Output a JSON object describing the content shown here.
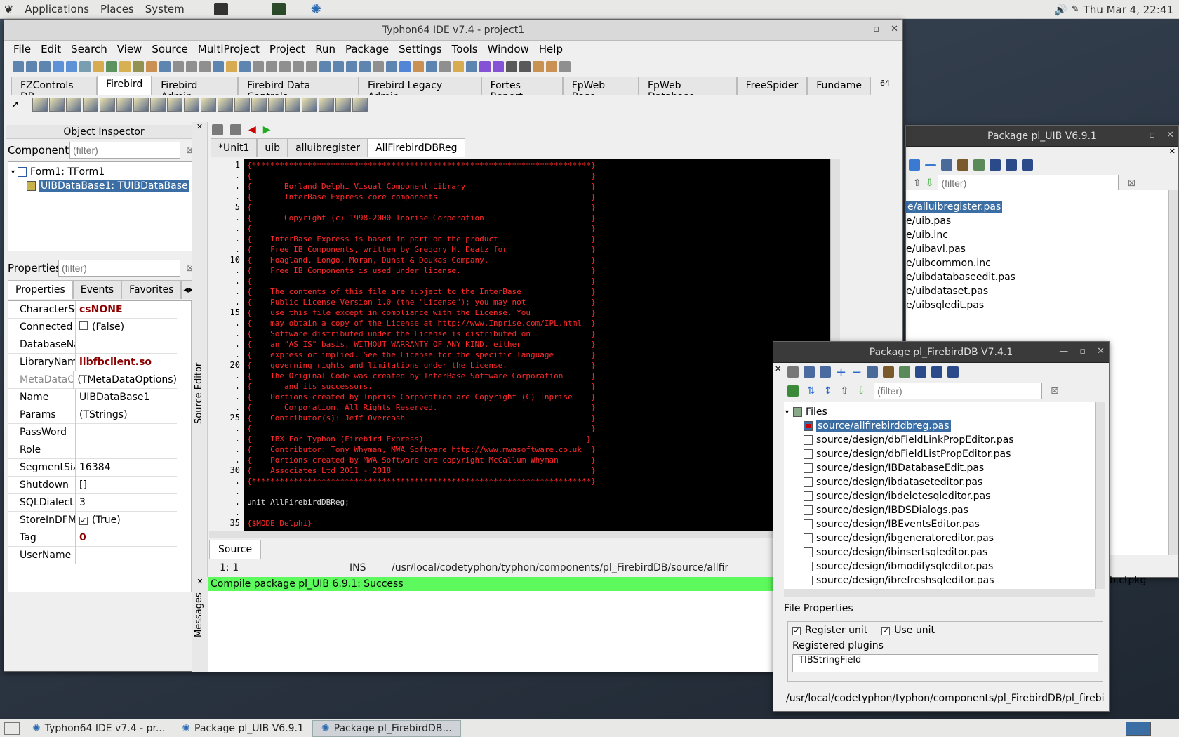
{
  "topbar": {
    "applications": "Applications",
    "places": "Places",
    "system": "System",
    "clock": "Thu Mar  4, 22:41"
  },
  "ide": {
    "title": "Typhon64 IDE v7.4 - project1",
    "menu": [
      "File",
      "Edit",
      "Search",
      "View",
      "Source",
      "MultiProject",
      "Project",
      "Run",
      "Package",
      "Settings",
      "Tools",
      "Window",
      "Help"
    ],
    "palette_tabs": [
      "FZControls DB",
      "Firebird",
      "Firebird Admin",
      "Firebird Data Controls",
      "Firebird Legacy Admin",
      "Fortes Report",
      "FpWeb Base",
      "FpWeb Database",
      "FreeSpider",
      "Fundame"
    ],
    "palette_selected": "Firebird",
    "palette_bits_label": "64"
  },
  "inspector": {
    "title": "Object Inspector",
    "components_label": "Components",
    "filter_placeholder": "(filter)",
    "tree": [
      "Form1: TForm1",
      "UIBDataBase1: TUIBDataBase"
    ],
    "properties_label": "Properties",
    "tabs": [
      "Properties",
      "Events",
      "Favorites"
    ],
    "props": [
      {
        "k": "CharacterSet",
        "v": "csNONE",
        "red": true
      },
      {
        "k": "Connected",
        "v": "(False)",
        "check": "off"
      },
      {
        "k": "DatabaseNam",
        "v": ""
      },
      {
        "k": "LibraryName",
        "v": "libfbclient.so",
        "red": true
      },
      {
        "k": "MetaDataOpt",
        "v": "(TMetaDataOptions)",
        "gray": true
      },
      {
        "k": "Name",
        "v": "UIBDataBase1"
      },
      {
        "k": "Params",
        "v": "(TStrings)"
      },
      {
        "k": "PassWord",
        "v": ""
      },
      {
        "k": "Role",
        "v": ""
      },
      {
        "k": "SegmentSize",
        "v": "16384"
      },
      {
        "k": "Shutdown",
        "v": "[]"
      },
      {
        "k": "SQLDialect",
        "v": "3"
      },
      {
        "k": "StoreInDFM",
        "v": "(True)",
        "check": "on"
      },
      {
        "k": "Tag",
        "v": "0",
        "red": true
      },
      {
        "k": "UserName",
        "v": ""
      }
    ]
  },
  "editor": {
    "side_label": "Source Editor",
    "tabs": [
      "*Unit1",
      "uib",
      "alluibregister",
      "AllFirebirdDBReg"
    ],
    "gutter": [
      "1",
      ".",
      ".",
      ".",
      "5",
      ".",
      ".",
      ".",
      ".",
      "10",
      ".",
      ".",
      ".",
      ".",
      "15",
      ".",
      ".",
      ".",
      ".",
      "20",
      ".",
      ".",
      ".",
      ".",
      "25",
      ".",
      ".",
      ".",
      ".",
      "30",
      ".",
      ".",
      ".",
      ".",
      "35"
    ],
    "lines": [
      "{*************************************************************************}",
      "{                                                                         }",
      "{       Borland Delphi Visual Component Library                           }",
      "{       InterBase Express core components                                 }",
      "{                                                                         }",
      "{       Copyright (c) 1998-2000 Inprise Corporation                       }",
      "{                                                                         }",
      "{    InterBase Express is based in part on the product                    }",
      "{    Free IB Components, written by Gregory H. Deatz for                  }",
      "{    Hoagland, Longo, Moran, Dunst & Doukas Company.                      }",
      "{    Free IB Components is used under license.                            }",
      "{                                                                         }",
      "{    The contents of this file are subject to the InterBase               }",
      "{    Public License Version 1.0 (the \"License\"); you may not              }",
      "{    use this file except in compliance with the License. You             }",
      "{    may obtain a copy of the License at http://www.Inprise.com/IPL.html  }",
      "{    Software distributed under the License is distributed on             }",
      "{    an \"AS IS\" basis, WITHOUT WARRANTY OF ANY KIND, either               }",
      "{    express or implied. See the License for the specific language        }",
      "{    governing rights and limitations under the License.                  }",
      "{    The Original Code was created by InterBase Software Corporation      }",
      "{       and its successors.                                               }",
      "{    Portions created by Inprise Corporation are Copyright (C) Inprise    }",
      "{       Corporation. All Rights Reserved.                                 }",
      "{    Contributor(s): Jeff Overcash                                        }",
      "{                                                                         }",
      "{    IBX For Typhon (Firebird Express)                                   }",
      "{    Contributor: Tony Whyman, MWA Software http://www.mwasoftware.co.uk  }",
      "{    Portions created by MWA Software are copyright McCallum Whyman       }",
      "{    Associates Ltd 2011 - 2018                                           }",
      "{*************************************************************************}",
      "",
      "unit AllFirebirdDBReg;",
      "",
      "{$MODE Delphi}"
    ],
    "bottom_tab": "Source",
    "status_pos": "1:  1",
    "status_mode": "INS",
    "status_path": "/usr/local/codetyphon/typhon/components/pl_FirebirdDB/source/allfir"
  },
  "messages": {
    "label": "Messages",
    "text": "Compile package pl_UIB 6.9.1: Success"
  },
  "pkg_uib": {
    "title": "Package pl_UIB V6.9.1",
    "filter_placeholder": "(filter)",
    "files": [
      "e/alluibregister.pas",
      "e/uib.pas",
      "e/uib.inc",
      "e/uibavl.pas",
      "e/uibcommon.inc",
      "e/uibdatabaseedit.pas",
      "e/uibdataset.pas",
      "e/uibsqledit.pas"
    ],
    "footer": "b.ctpkg"
  },
  "pkg_fb": {
    "title": "Package pl_FirebirdDB V7.4.1",
    "filter_placeholder": "(filter)",
    "root": "Files",
    "files": [
      "source/allfirebirddbreg.pas",
      "source/design/dbFieldLinkPropEditor.pas",
      "source/design/dbFieldListPropEditor.pas",
      "source/design/IBDatabaseEdit.pas",
      "source/design/ibdataseteditor.pas",
      "source/design/ibdeletesqleditor.pas",
      "source/design/IBDSDialogs.pas",
      "source/design/IBEventsEditor.pas",
      "source/design/ibgeneratoreditor.pas",
      "source/design/ibinsertsqleditor.pas",
      "source/design/ibmodifysqleditor.pas",
      "source/design/ibrefreshsqleditor.pas"
    ],
    "file_props_label": "File Properties",
    "register_unit": "Register unit",
    "use_unit": "Use unit",
    "plugins_label": "Registered plugins",
    "plugin": "TIBStringField",
    "path": "/usr/local/codetyphon/typhon/components/pl_FirebirdDB/pl_firebi"
  },
  "taskbar": [
    "Typhon64 IDE v7.4 - pr...",
    "Package pl_UIB V6.9.1",
    "Package pl_FirebirdDB..."
  ]
}
